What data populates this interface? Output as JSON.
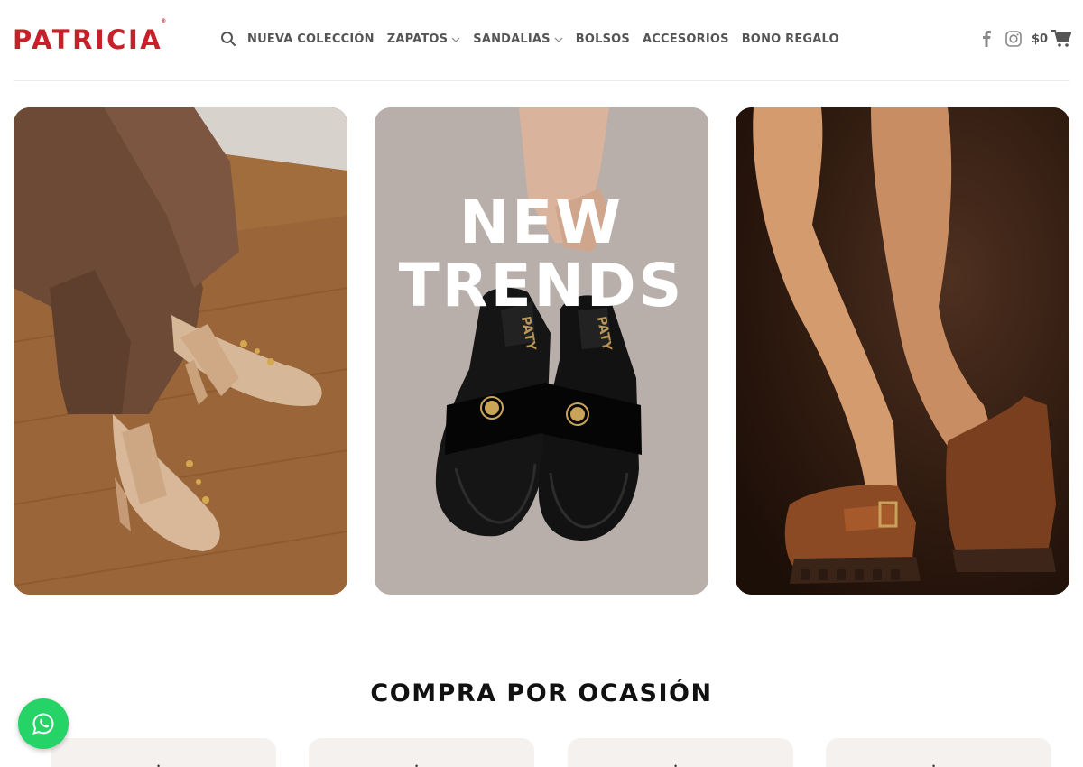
{
  "header": {
    "brand": "PATRICIA",
    "brand_mark": "®",
    "nav": [
      {
        "label": "NUEVA COLECCIÓN",
        "dropdown": false
      },
      {
        "label": "ZAPATOS",
        "dropdown": true
      },
      {
        "label": "SANDALIAS",
        "dropdown": true
      },
      {
        "label": "BOLSOS",
        "dropdown": false
      },
      {
        "label": "ACCESORIOS",
        "dropdown": false
      },
      {
        "label": "BONO REGALO",
        "dropdown": false
      }
    ],
    "icons": {
      "search": "search-icon",
      "facebook": "facebook-icon",
      "instagram": "instagram-icon",
      "cart": "cart-icon"
    },
    "cart_amount": "$0"
  },
  "banners": {
    "center_line1": "NEW",
    "center_line2": "TRENDS",
    "shoe_brand": "PATY"
  },
  "section": {
    "title": "COMPRA POR OCASIÓN"
  },
  "colors": {
    "brand_red": "#c6202a",
    "whatsapp_green": "#25d366",
    "nav_text": "#555555"
  }
}
